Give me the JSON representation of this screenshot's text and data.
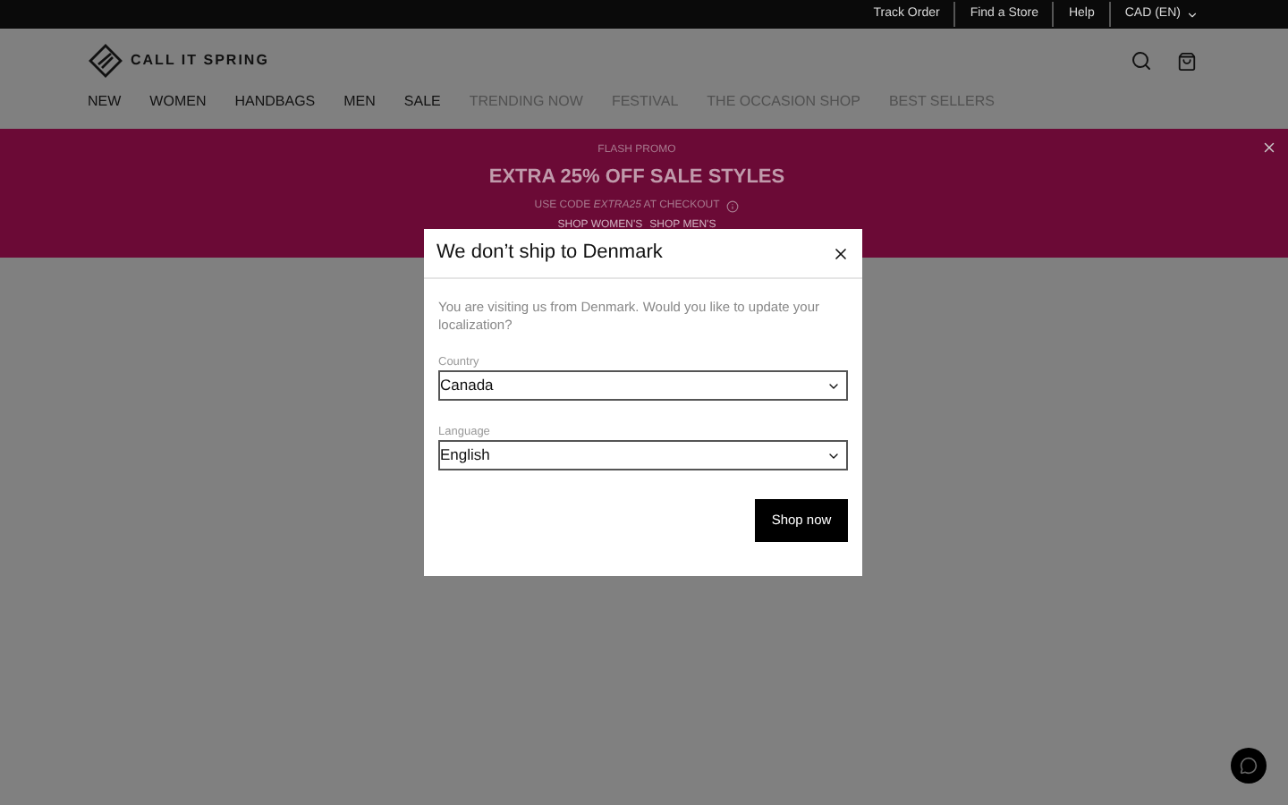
{
  "utility_bar": {
    "links": [
      "Track Order",
      "Find a Store",
      "Help"
    ],
    "currency": "CAD (EN)"
  },
  "header": {
    "logo_text": "CALL IT SPRING"
  },
  "nav": [
    {
      "label": "NEW",
      "muted": false
    },
    {
      "label": "WOMEN",
      "muted": false
    },
    {
      "label": "HANDBAGS",
      "muted": false
    },
    {
      "label": "MEN",
      "muted": false
    },
    {
      "label": "SALE",
      "muted": false
    },
    {
      "label": "TRENDING NOW",
      "muted": true
    },
    {
      "label": "FESTIVAL",
      "muted": true
    },
    {
      "label": "THE OCCASION SHOP",
      "muted": true
    },
    {
      "label": "BEST SELLERS",
      "muted": true
    }
  ],
  "promo": {
    "eyebrow": "FLASH PROMO",
    "headline": "EXTRA 25% OFF SALE STYLES",
    "code_line": "USE CODE *EXTRA25* AT CHECKOUT",
    "links": [
      "SHOP WOMEN'S",
      "SHOP MEN'S"
    ]
  },
  "dialog": {
    "title": "We don’t ship to Denmark",
    "message": "You are visiting us from Denmark. Would you like to update your localization?",
    "fields": [
      {
        "label": "Country",
        "value": "Canada"
      },
      {
        "label": "Language",
        "value": "English"
      }
    ],
    "button": "Shop now"
  }
}
